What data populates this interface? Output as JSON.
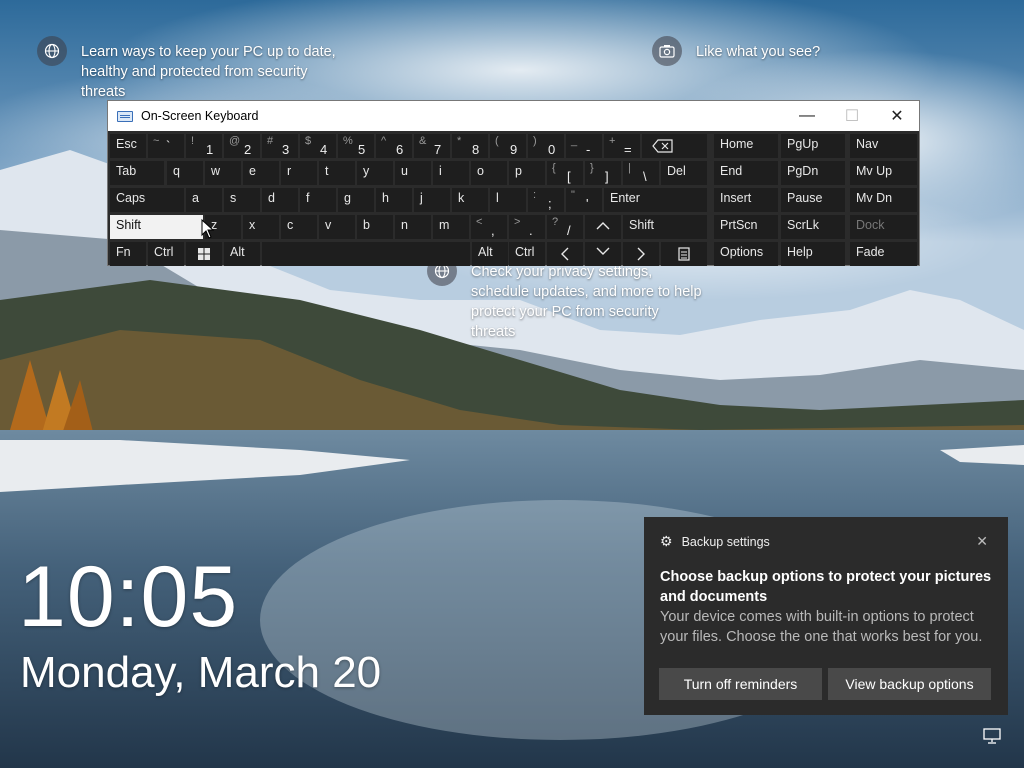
{
  "tips": [
    {
      "text": "Learn ways to keep your PC up to date, healthy and protected from security threats",
      "icon": "globe-icon"
    },
    {
      "text": "Like what you see?",
      "icon": "camera-icon"
    },
    {
      "text": "Check your privacy settings, schedule updates, and more to help protect your PC from security threats",
      "icon": "globe-icon"
    }
  ],
  "clock": {
    "time": "10:05",
    "date": "Monday, March 20"
  },
  "osk": {
    "title": "On-Screen Keyboard",
    "window_controls": {
      "minimize": "—",
      "maximize": "☐",
      "close": "✕"
    },
    "keys": {
      "esc": "Esc",
      "backtick_sh": "~",
      "backtick": "`",
      "k1_sh": "!",
      "k1": "1",
      "k2_sh": "@",
      "k2": "2",
      "k3_sh": "#",
      "k3": "3",
      "k4_sh": "$",
      "k4": "4",
      "k5_sh": "%",
      "k5": "5",
      "k6_sh": "^",
      "k6": "6",
      "k7_sh": "&",
      "k7": "7",
      "k8_sh": "*",
      "k8": "8",
      "k9_sh": "(",
      "k9": "9",
      "k0_sh": ")",
      "k0": "0",
      "minus_sh": "_",
      "minus": "-",
      "eq_sh": "+",
      "eq": "=",
      "home": "Home",
      "pgup": "PgUp",
      "nav": "Nav",
      "tab": "Tab",
      "q": "q",
      "w": "w",
      "e": "e",
      "r": "r",
      "t": "t",
      "y": "y",
      "u": "u",
      "i": "i",
      "o": "o",
      "p": "p",
      "lbr_sh": "{",
      "lbr": "[",
      "rbr_sh": "}",
      "rbr": "]",
      "bsl_sh": "|",
      "bsl": "\\",
      "del": "Del",
      "end": "End",
      "pgdn": "PgDn",
      "mvup": "Mv Up",
      "caps": "Caps",
      "a": "a",
      "s": "s",
      "d": "d",
      "f": "f",
      "g": "g",
      "h": "h",
      "j": "j",
      "k": "k",
      "l": "l",
      "semi_sh": ":",
      "semi": ";",
      "quote_sh": "\"",
      "quote": "'",
      "enter": "Enter",
      "insert": "Insert",
      "pause": "Pause",
      "mvdn": "Mv Dn",
      "shift_l": "Shift",
      "z": "z",
      "x": "x",
      "c": "c",
      "v": "v",
      "b": "b",
      "n": "n",
      "m": "m",
      "comma_sh": "<",
      "comma": ",",
      "period_sh": ">",
      "period": ".",
      "slash_sh": "?",
      "slash": "/",
      "shift_r": "Shift",
      "prtscn": "PrtScn",
      "scrlk": "ScrLk",
      "dock": "Dock",
      "fn": "Fn",
      "ctrl_l": "Ctrl",
      "alt_l": "Alt",
      "alt_r": "Alt",
      "ctrl_r": "Ctrl",
      "options": "Options",
      "help": "Help",
      "fade": "Fade"
    }
  },
  "notification": {
    "app": "Backup settings",
    "title": "Choose backup options to protect your pictures and documents",
    "body": "Your device comes with built-in options to protect your files. Choose the one that works best for you.",
    "buttons": [
      "Turn off reminders",
      "View backup options"
    ]
  }
}
